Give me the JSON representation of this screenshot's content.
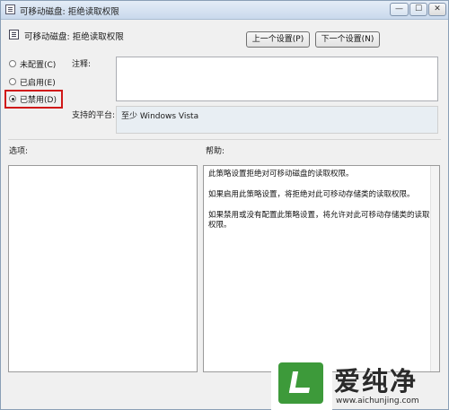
{
  "window": {
    "title": "可移动磁盘: 拒绝读取权限",
    "controls": {
      "minimize": "—",
      "maximize": "☐",
      "close": "✕"
    }
  },
  "header": {
    "setting_name": "可移动磁盘: 拒绝读取权限",
    "prev_button": "上一个设置(P)",
    "next_button": "下一个设置(N)"
  },
  "state": {
    "options": [
      {
        "label": "未配置(C)",
        "selected": false
      },
      {
        "label": "已启用(E)",
        "selected": false
      },
      {
        "label": "已禁用(D)",
        "selected": true
      }
    ]
  },
  "comment": {
    "label": "注释:",
    "value": ""
  },
  "platform": {
    "label": "支持的平台:",
    "value": "至少 Windows Vista"
  },
  "options_panel": {
    "label": "选项:"
  },
  "help_panel": {
    "label": "帮助:",
    "paragraphs": [
      "此策略设置拒绝对可移动磁盘的读取权限。",
      "如果启用此策略设置，将拒绝对此可移动存储类的读取权限。",
      "如果禁用或没有配置此策略设置，将允许对此可移动存储类的读取权限。"
    ]
  },
  "watermark": {
    "name": "爱纯净",
    "url": "www.aichunjing.com"
  },
  "colors": {
    "highlight": "#d01818",
    "watermark_green": "#3d9a3a",
    "platform_bg": "#e8eef3"
  }
}
